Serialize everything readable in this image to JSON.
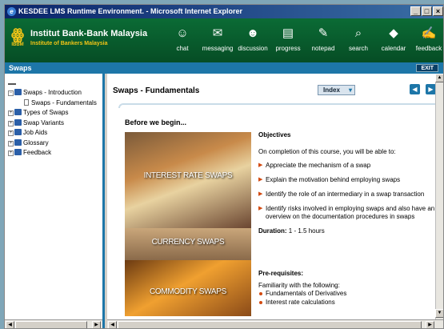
{
  "window": {
    "title": "KESDEE LMS Runtime Environment. - Microsoft Internet Explorer",
    "controls": [
      "_",
      "□",
      "×"
    ]
  },
  "banner": {
    "logo_mark": "IBBM",
    "brand_line1": "Institut Bank-Bank Malaysia",
    "brand_line2": "Institute of Bankers Malaysia",
    "nav": [
      {
        "label": "chat",
        "icon": "chat-icon",
        "glyph": "☺"
      },
      {
        "label": "messaging",
        "icon": "envelope-icon",
        "glyph": "✉"
      },
      {
        "label": "discussion",
        "icon": "discussion-icon",
        "glyph": "☻"
      },
      {
        "label": "progress",
        "icon": "progress-icon",
        "glyph": "▤"
      },
      {
        "label": "notepad",
        "icon": "notepad-icon",
        "glyph": "✎"
      },
      {
        "label": "search",
        "icon": "search-icon",
        "glyph": "⌕"
      },
      {
        "label": "calendar",
        "icon": "calendar-icon",
        "glyph": "◆"
      },
      {
        "label": "feedback",
        "icon": "feedback-icon",
        "glyph": "✍"
      }
    ]
  },
  "section": {
    "title": "Swaps",
    "exit_label": "EXIT"
  },
  "tree": {
    "items": [
      {
        "label": "Swaps - Introduction",
        "expander": "−"
      },
      {
        "label": "Swaps - Fundamentals"
      },
      {
        "label": "Types of Swaps",
        "expander": "+"
      },
      {
        "label": "Swap Variants",
        "expander": "+"
      },
      {
        "label": "Job Aids",
        "expander": "+"
      },
      {
        "label": "Glossary",
        "expander": "+"
      },
      {
        "label": "Feedback",
        "expander": "+"
      }
    ]
  },
  "content": {
    "page_title": "Swaps - Fundamentals",
    "index_label": "Index",
    "before_heading": "Before we begin...",
    "hero_labels": [
      "INTEREST RATE SWAPS",
      "CURRENCY SWAPS",
      "COMMODITY SWAPS"
    ],
    "objectives_heading": "Objectives",
    "objectives_intro": "On completion of this course, you will be able to:",
    "objectives": [
      "Appreciate the mechanism of a swap",
      "Explain the motivation behind employing swaps",
      "Identify the role of an intermediary in a swap transaction",
      "Identify risks involved in employing swaps and also have an overview on the documentation procedures in swaps"
    ],
    "duration_label": "Duration:",
    "duration_value": "1 - 1.5 hours",
    "prereq_heading": "Pre-requisites:",
    "prereq_intro": "Familiarity with the following:",
    "prereqs": [
      "Fundamentals of Derivatives",
      "Interest rate calculations"
    ]
  },
  "colors": {
    "banner_green": "#0b6b35",
    "section_blue": "#1d76a8",
    "bullet_orange": "#d24a10"
  }
}
